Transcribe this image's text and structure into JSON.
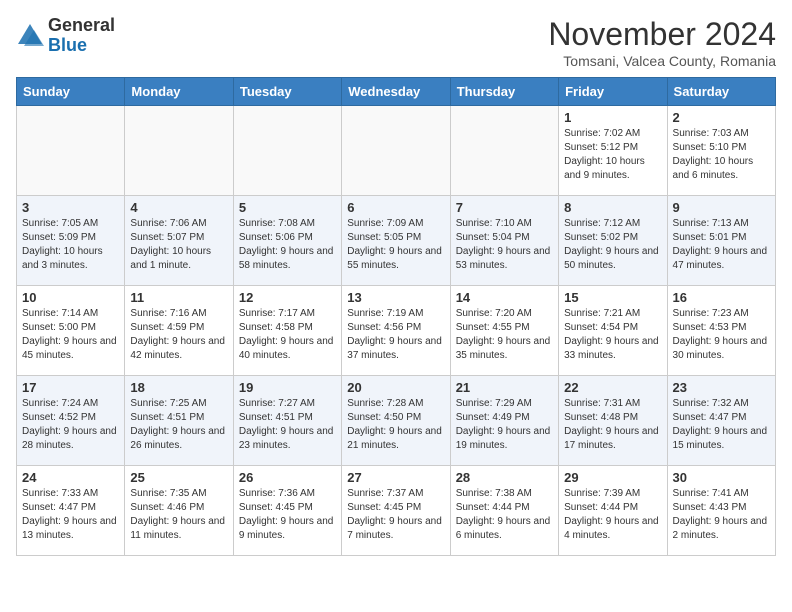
{
  "logo": {
    "general": "General",
    "blue": "Blue"
  },
  "title": "November 2024",
  "subtitle": "Tomsani, Valcea County, Romania",
  "headers": [
    "Sunday",
    "Monday",
    "Tuesday",
    "Wednesday",
    "Thursday",
    "Friday",
    "Saturday"
  ],
  "rows": [
    [
      {
        "num": "",
        "info": ""
      },
      {
        "num": "",
        "info": ""
      },
      {
        "num": "",
        "info": ""
      },
      {
        "num": "",
        "info": ""
      },
      {
        "num": "",
        "info": ""
      },
      {
        "num": "1",
        "info": "Sunrise: 7:02 AM\nSunset: 5:12 PM\nDaylight: 10 hours and 9 minutes."
      },
      {
        "num": "2",
        "info": "Sunrise: 7:03 AM\nSunset: 5:10 PM\nDaylight: 10 hours and 6 minutes."
      }
    ],
    [
      {
        "num": "3",
        "info": "Sunrise: 7:05 AM\nSunset: 5:09 PM\nDaylight: 10 hours and 3 minutes."
      },
      {
        "num": "4",
        "info": "Sunrise: 7:06 AM\nSunset: 5:07 PM\nDaylight: 10 hours and 1 minute."
      },
      {
        "num": "5",
        "info": "Sunrise: 7:08 AM\nSunset: 5:06 PM\nDaylight: 9 hours and 58 minutes."
      },
      {
        "num": "6",
        "info": "Sunrise: 7:09 AM\nSunset: 5:05 PM\nDaylight: 9 hours and 55 minutes."
      },
      {
        "num": "7",
        "info": "Sunrise: 7:10 AM\nSunset: 5:04 PM\nDaylight: 9 hours and 53 minutes."
      },
      {
        "num": "8",
        "info": "Sunrise: 7:12 AM\nSunset: 5:02 PM\nDaylight: 9 hours and 50 minutes."
      },
      {
        "num": "9",
        "info": "Sunrise: 7:13 AM\nSunset: 5:01 PM\nDaylight: 9 hours and 47 minutes."
      }
    ],
    [
      {
        "num": "10",
        "info": "Sunrise: 7:14 AM\nSunset: 5:00 PM\nDaylight: 9 hours and 45 minutes."
      },
      {
        "num": "11",
        "info": "Sunrise: 7:16 AM\nSunset: 4:59 PM\nDaylight: 9 hours and 42 minutes."
      },
      {
        "num": "12",
        "info": "Sunrise: 7:17 AM\nSunset: 4:58 PM\nDaylight: 9 hours and 40 minutes."
      },
      {
        "num": "13",
        "info": "Sunrise: 7:19 AM\nSunset: 4:56 PM\nDaylight: 9 hours and 37 minutes."
      },
      {
        "num": "14",
        "info": "Sunrise: 7:20 AM\nSunset: 4:55 PM\nDaylight: 9 hours and 35 minutes."
      },
      {
        "num": "15",
        "info": "Sunrise: 7:21 AM\nSunset: 4:54 PM\nDaylight: 9 hours and 33 minutes."
      },
      {
        "num": "16",
        "info": "Sunrise: 7:23 AM\nSunset: 4:53 PM\nDaylight: 9 hours and 30 minutes."
      }
    ],
    [
      {
        "num": "17",
        "info": "Sunrise: 7:24 AM\nSunset: 4:52 PM\nDaylight: 9 hours and 28 minutes."
      },
      {
        "num": "18",
        "info": "Sunrise: 7:25 AM\nSunset: 4:51 PM\nDaylight: 9 hours and 26 minutes."
      },
      {
        "num": "19",
        "info": "Sunrise: 7:27 AM\nSunset: 4:51 PM\nDaylight: 9 hours and 23 minutes."
      },
      {
        "num": "20",
        "info": "Sunrise: 7:28 AM\nSunset: 4:50 PM\nDaylight: 9 hours and 21 minutes."
      },
      {
        "num": "21",
        "info": "Sunrise: 7:29 AM\nSunset: 4:49 PM\nDaylight: 9 hours and 19 minutes."
      },
      {
        "num": "22",
        "info": "Sunrise: 7:31 AM\nSunset: 4:48 PM\nDaylight: 9 hours and 17 minutes."
      },
      {
        "num": "23",
        "info": "Sunrise: 7:32 AM\nSunset: 4:47 PM\nDaylight: 9 hours and 15 minutes."
      }
    ],
    [
      {
        "num": "24",
        "info": "Sunrise: 7:33 AM\nSunset: 4:47 PM\nDaylight: 9 hours and 13 minutes."
      },
      {
        "num": "25",
        "info": "Sunrise: 7:35 AM\nSunset: 4:46 PM\nDaylight: 9 hours and 11 minutes."
      },
      {
        "num": "26",
        "info": "Sunrise: 7:36 AM\nSunset: 4:45 PM\nDaylight: 9 hours and 9 minutes."
      },
      {
        "num": "27",
        "info": "Sunrise: 7:37 AM\nSunset: 4:45 PM\nDaylight: 9 hours and 7 minutes."
      },
      {
        "num": "28",
        "info": "Sunrise: 7:38 AM\nSunset: 4:44 PM\nDaylight: 9 hours and 6 minutes."
      },
      {
        "num": "29",
        "info": "Sunrise: 7:39 AM\nSunset: 4:44 PM\nDaylight: 9 hours and 4 minutes."
      },
      {
        "num": "30",
        "info": "Sunrise: 7:41 AM\nSunset: 4:43 PM\nDaylight: 9 hours and 2 minutes."
      }
    ]
  ]
}
